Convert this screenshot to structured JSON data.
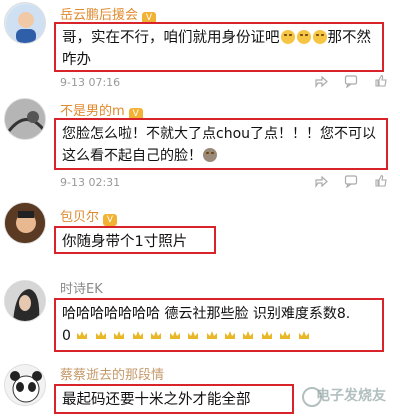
{
  "comments": [
    {
      "username": "岳云鹏后援会",
      "text_parts": [
        "哥，实在不行，咱们就用身份证吧",
        "那不然咋办"
      ],
      "time": "9-13 07:16"
    },
    {
      "username": "不是男的m",
      "text": "您脸怎么啦！不就大了点chou了点！！！您不可以这么看不起自己的脸！",
      "time": "9-13 02:31"
    },
    {
      "username": "包贝尔",
      "text": "你随身带个1寸照片"
    },
    {
      "username": "时诗EK",
      "text_line1": "哈哈哈哈哈哈哈 德云社那些脸 识别难度系数8.",
      "text_line2": "0"
    },
    {
      "username": "蔡蔡逝去的那段情",
      "text": "最起码还要十米之外才能全部"
    }
  ],
  "watermark": "电子发烧友"
}
